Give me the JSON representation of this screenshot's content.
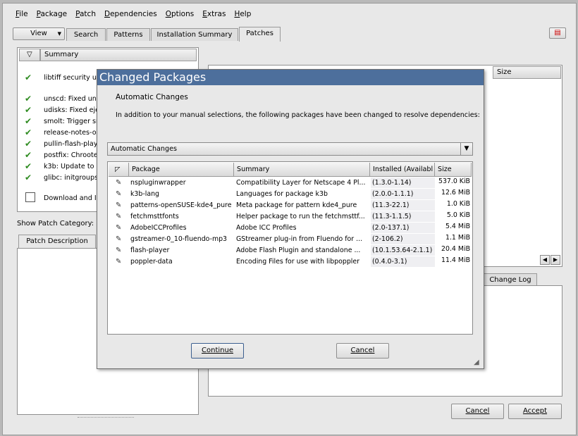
{
  "menu": [
    "File",
    "Package",
    "Patch",
    "Dependencies",
    "Options",
    "Extras",
    "Help"
  ],
  "tabs": {
    "view": "View",
    "search": "Search",
    "patterns": "Patterns",
    "installation_summary": "Installation Summary",
    "patches": "Patches"
  },
  "patch_list": {
    "header": "Summary",
    "items": [
      "libtiff security up",
      "unscd: Fixed un",
      "udisks: Fixed eje",
      "smolt: Trigger sr",
      "release-notes-op",
      "pullin-flash-play",
      "postfix: Chrooted",
      "k3b: Update to 2",
      "glibc: initgroups"
    ],
    "download_item": "Download and I"
  },
  "show_patch_category": "Show Patch Category:",
  "patch_description_tab": "Patch Description",
  "right_panel": {
    "size_header": "Size",
    "change_log_tab": "Change Log"
  },
  "bottom_buttons": {
    "cancel": "Cancel",
    "accept": "Accept"
  },
  "dialog": {
    "title": "Changed Packages",
    "heading": "Automatic Changes",
    "message": "In addition to your manual selections, the following packages have been changed to resolve dependencies:",
    "combo_value": "Automatic Changes",
    "columns": {
      "package": "Package",
      "summary": "Summary",
      "installed": "Installed (Availabl",
      "size": "Size"
    },
    "rows": [
      {
        "package": "nspluginwrapper",
        "summary": "Compatibility Layer for Netscape 4 Pl...",
        "installed": "(1.3.0-1.14)",
        "size": "537.0 KiB"
      },
      {
        "package": "k3b-lang",
        "summary": "Languages for package k3b",
        "installed": "(2.0.0-1.1.1)",
        "size": "12.6 MiB"
      },
      {
        "package": "patterns-openSUSE-kde4_pure",
        "summary": "Meta package for pattern kde4_pure",
        "installed": "(11.3-22.1)",
        "size": "1.0 KiB"
      },
      {
        "package": "fetchmsttfonts",
        "summary": "Helper package to run the fetchmsttf...",
        "installed": "(11.3-1.1.5)",
        "size": "5.0 KiB"
      },
      {
        "package": "AdobeICCProfiles",
        "summary": "Adobe ICC Profiles",
        "installed": "(2.0-137.1)",
        "size": "5.4 MiB"
      },
      {
        "package": "gstreamer-0_10-fluendo-mp3",
        "summary": "GStreamer plug-in from Fluendo for ...",
        "installed": "(2-106.2)",
        "size": "1.1 MiB"
      },
      {
        "package": "flash-player",
        "summary": "Adobe Flash Plugin and standalone ...",
        "installed": "(10.1.53.64-2.1.1)",
        "size": "20.4 MiB"
      },
      {
        "package": "poppler-data",
        "summary": "Encoding Files for use with libpoppler",
        "installed": "(0.4.0-3.1)",
        "size": "11.4 MiB"
      }
    ],
    "continue_button": "Continue",
    "cancel_button": "Cancel"
  }
}
